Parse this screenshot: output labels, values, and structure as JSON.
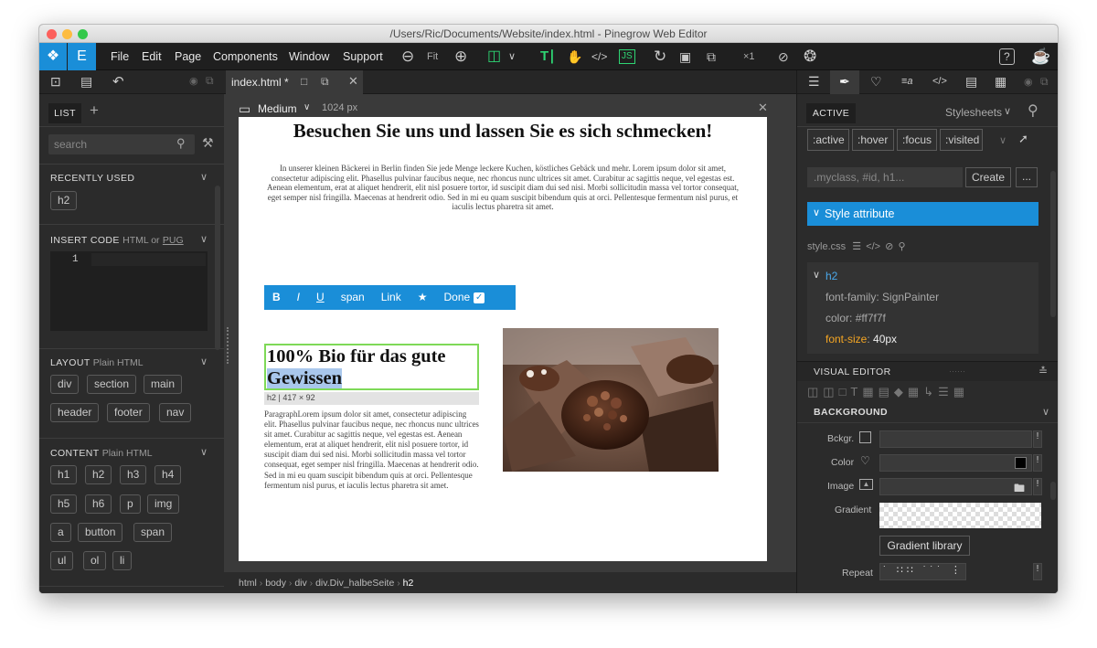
{
  "window": {
    "title": "/Users/Ric/Documents/Website/index.html - Pinegrow Web Editor"
  },
  "menu": [
    "File",
    "Edit",
    "Page",
    "Components",
    "Window",
    "Support"
  ],
  "toolbar": {
    "fit_label": "Fit",
    "zoom_label": "×1"
  },
  "tab": {
    "label": "index.html *"
  },
  "device": {
    "label": "Medium",
    "width": "1024 px"
  },
  "left_panel": {
    "list_tab": "LIST",
    "search_placeholder": "search",
    "recently_used": {
      "title": "RECENTLY USED",
      "items": [
        "h2"
      ]
    },
    "insert_code": {
      "title": "INSERT CODE",
      "sub": "HTML or",
      "pug": "PUG",
      "line_no": "1"
    },
    "layout": {
      "title": "LAYOUT",
      "sub": "Plain HTML",
      "items": [
        "div",
        "section",
        "main",
        "header",
        "footer",
        "nav"
      ]
    },
    "content": {
      "title": "CONTENT",
      "sub": "Plain HTML",
      "items": [
        "h1",
        "h2",
        "h3",
        "h4",
        "h5",
        "h6",
        "p",
        "img",
        "a",
        "button",
        "span",
        "ul",
        "ol",
        "li"
      ]
    }
  },
  "page": {
    "heading": "Besuchen Sie uns und lassen Sie es sich schmecken!",
    "intro": "In unserer kleinen Bäckerei in Berlin finden Sie jede Menge leckere Kuchen, köstliches Gebäck und mehr.  Lorem ipsum dolor sit amet, consectetur adipiscing elit. Phasellus pulvinar faucibus neque, nec rhoncus nunc ultrices sit amet. Curabitur ac sagittis neque, vel egestas est. Aenean elementum, erat at aliquet hendrerit, elit nisl posuere tortor, id suscipit diam dui sed nisi. Morbi sollicitudin massa vel tortor consequat, eget semper nisl fringilla. Maecenas at hendrerit odio. Sed in mi eu quam suscipit bibendum quis at orci. Pellentesque fermentum nisl purus, et iaculis lectus pharetra sit amet.",
    "h2_line1": "100% Bio für das gute",
    "h2_line2": "Gewissen",
    "h2_badge": "h2 | 417 × 92",
    "paragraph": "ParagraphLorem ipsum dolor sit amet, consectetur adipiscing elit. Phasellus pulvinar faucibus neque, nec rhoncus nunc ultrices sit amet. Curabitur ac sagittis neque, vel egestas est. Aenean elementum, erat at aliquet hendrerit, elit nisl posuere tortor, id suscipit diam dui sed nisi. Morbi sollicitudin massa vel tortor consequat, eget semper nisl fringilla. Maecenas at hendrerit odio. Sed in mi eu quam suscipit bibendum quis at orci. Pellentesque fermentum nisl purus, et iaculis lectus pharetra sit amet."
  },
  "editor_toolbar": {
    "bold": "B",
    "italic": "I",
    "underline": "U",
    "span": "span",
    "link": "Link",
    "star": "★",
    "done": "Done"
  },
  "breadcrumb": [
    "html",
    "body",
    "div",
    "div.Div_halbeSeite",
    "h2"
  ],
  "right_panel": {
    "active_tab": "ACTIVE",
    "stylesheets_label": "Stylesheets",
    "states": [
      ":active",
      ":hover",
      ":focus",
      ":visited"
    ],
    "selector_placeholder": ".myclass, #id, h1...",
    "create_label": "Create",
    "more_label": "...",
    "style_attribute": "Style attribute",
    "stylesheet_file": "style.css",
    "rule_selector": "h2",
    "declarations": [
      {
        "prop": "font-family",
        "value": "SignPainter"
      },
      {
        "prop": "color",
        "value": "#ff7f7f"
      },
      {
        "prop": "font-size",
        "value": "40px"
      }
    ],
    "visual_editor": "VISUAL EDITOR",
    "background_title": "BACKGROUND",
    "bg_rows": {
      "bckgr": "Bckgr.",
      "color": "Color",
      "image": "Image",
      "gradient": "Gradient",
      "repeat": "Repeat"
    },
    "gradient_library": "Gradient library"
  },
  "colors": {
    "accent": "#1a8ed8",
    "green": "#2ed573",
    "orange": "#f5a623",
    "panel": "#2b2b2b"
  }
}
